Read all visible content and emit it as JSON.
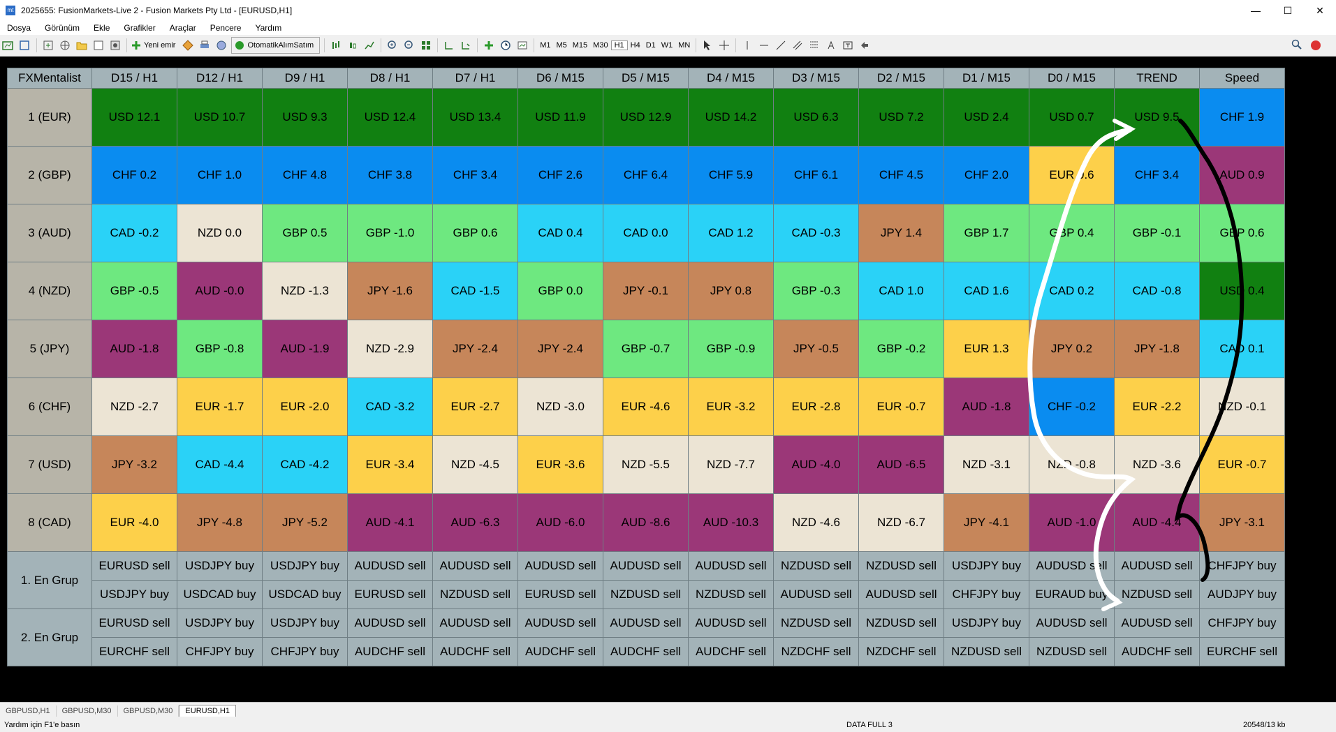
{
  "window": {
    "title": "2025655: FusionMarkets-Live 2 - Fusion Markets Pty Ltd - [EURUSD,H1]",
    "app_icon": "mt",
    "minimize": "—",
    "maximize": "☐",
    "close": "✕"
  },
  "menu": [
    "Dosya",
    "Görünüm",
    "Ekle",
    "Grafikler",
    "Araçlar",
    "Pencere",
    "Yardım"
  ],
  "toolbar": {
    "new_order": "Yeni emir",
    "auto_trading": "OtomatikAlımSatım",
    "timeframes": [
      "M1",
      "M5",
      "M15",
      "M30",
      "H1",
      "H4",
      "D1",
      "W1",
      "MN"
    ]
  },
  "grid": {
    "corner": "FXMentalist",
    "columns": [
      "D15 / H1",
      "D12 / H1",
      "D9 / H1",
      "D8 / H1",
      "D7 / H1",
      "D6 / M15",
      "D5 / M15",
      "D4 / M15",
      "D3 / M15",
      "D2 / M15",
      "D1 / M15",
      "D0 / M15",
      "TREND",
      "Speed"
    ],
    "rows": [
      {
        "label": "1 (EUR)",
        "cells": [
          {
            "t": "USD 12.1",
            "c": "#118011"
          },
          {
            "t": "USD 10.7",
            "c": "#118011"
          },
          {
            "t": "USD 9.3",
            "c": "#118011"
          },
          {
            "t": "USD 12.4",
            "c": "#118011"
          },
          {
            "t": "USD 13.4",
            "c": "#118011"
          },
          {
            "t": "USD 11.9",
            "c": "#118011"
          },
          {
            "t": "USD 12.9",
            "c": "#118011"
          },
          {
            "t": "USD 14.2",
            "c": "#118011"
          },
          {
            "t": "USD 6.3",
            "c": "#118011"
          },
          {
            "t": "USD 7.2",
            "c": "#118011"
          },
          {
            "t": "USD 2.4",
            "c": "#118011"
          },
          {
            "t": "USD 0.7",
            "c": "#118011"
          },
          {
            "t": "USD 9.5",
            "c": "#118011"
          },
          {
            "t": "CHF 1.9",
            "c": "#0a8cf0"
          }
        ]
      },
      {
        "label": "2 (GBP)",
        "cells": [
          {
            "t": "CHF 0.2",
            "c": "#0a8cf0"
          },
          {
            "t": "CHF 1.0",
            "c": "#0a8cf0"
          },
          {
            "t": "CHF 4.8",
            "c": "#0a8cf0"
          },
          {
            "t": "CHF 3.8",
            "c": "#0a8cf0"
          },
          {
            "t": "CHF 3.4",
            "c": "#0a8cf0"
          },
          {
            "t": "CHF 2.6",
            "c": "#0a8cf0"
          },
          {
            "t": "CHF 6.4",
            "c": "#0a8cf0"
          },
          {
            "t": "CHF 5.9",
            "c": "#0a8cf0"
          },
          {
            "t": "CHF 6.1",
            "c": "#0a8cf0"
          },
          {
            "t": "CHF 4.5",
            "c": "#0a8cf0"
          },
          {
            "t": "CHF 2.0",
            "c": "#0a8cf0"
          },
          {
            "t": "EUR 0.6",
            "c": "#fdd04a"
          },
          {
            "t": "CHF 3.4",
            "c": "#0a8cf0"
          },
          {
            "t": "AUD 0.9",
            "c": "#9b3778"
          }
        ]
      },
      {
        "label": "3 (AUD)",
        "cells": [
          {
            "t": "CAD -0.2",
            "c": "#2ad2f7"
          },
          {
            "t": "NZD 0.0",
            "c": "#ece4d4"
          },
          {
            "t": "GBP 0.5",
            "c": "#6ee880"
          },
          {
            "t": "GBP -1.0",
            "c": "#6ee880"
          },
          {
            "t": "GBP 0.6",
            "c": "#6ee880"
          },
          {
            "t": "CAD 0.4",
            "c": "#2ad2f7"
          },
          {
            "t": "CAD 0.0",
            "c": "#2ad2f7"
          },
          {
            "t": "CAD 1.2",
            "c": "#2ad2f7"
          },
          {
            "t": "CAD -0.3",
            "c": "#2ad2f7"
          },
          {
            "t": "JPY 1.4",
            "c": "#c6865a"
          },
          {
            "t": "GBP 1.7",
            "c": "#6ee880"
          },
          {
            "t": "GBP 0.4",
            "c": "#6ee880"
          },
          {
            "t": "GBP -0.1",
            "c": "#6ee880"
          },
          {
            "t": "GBP 0.6",
            "c": "#6ee880"
          }
        ]
      },
      {
        "label": "4 (NZD)",
        "cells": [
          {
            "t": "GBP -0.5",
            "c": "#6ee880"
          },
          {
            "t": "AUD -0.0",
            "c": "#9b3778"
          },
          {
            "t": "NZD -1.3",
            "c": "#ece4d4"
          },
          {
            "t": "JPY -1.6",
            "c": "#c6865a"
          },
          {
            "t": "CAD -1.5",
            "c": "#2ad2f7"
          },
          {
            "t": "GBP 0.0",
            "c": "#6ee880"
          },
          {
            "t": "JPY -0.1",
            "c": "#c6865a"
          },
          {
            "t": "JPY 0.8",
            "c": "#c6865a"
          },
          {
            "t": "GBP -0.3",
            "c": "#6ee880"
          },
          {
            "t": "CAD 1.0",
            "c": "#2ad2f7"
          },
          {
            "t": "CAD 1.6",
            "c": "#2ad2f7"
          },
          {
            "t": "CAD 0.2",
            "c": "#2ad2f7"
          },
          {
            "t": "CAD -0.8",
            "c": "#2ad2f7"
          },
          {
            "t": "USD 0.4",
            "c": "#118011"
          }
        ]
      },
      {
        "label": "5 (JPY)",
        "cells": [
          {
            "t": "AUD -1.8",
            "c": "#9b3778"
          },
          {
            "t": "GBP -0.8",
            "c": "#6ee880"
          },
          {
            "t": "AUD -1.9",
            "c": "#9b3778"
          },
          {
            "t": "NZD -2.9",
            "c": "#ece4d4"
          },
          {
            "t": "JPY -2.4",
            "c": "#c6865a"
          },
          {
            "t": "JPY -2.4",
            "c": "#c6865a"
          },
          {
            "t": "GBP -0.7",
            "c": "#6ee880"
          },
          {
            "t": "GBP -0.9",
            "c": "#6ee880"
          },
          {
            "t": "JPY -0.5",
            "c": "#c6865a"
          },
          {
            "t": "GBP -0.2",
            "c": "#6ee880"
          },
          {
            "t": "EUR 1.3",
            "c": "#fdd04a"
          },
          {
            "t": "JPY 0.2",
            "c": "#c6865a"
          },
          {
            "t": "JPY -1.8",
            "c": "#c6865a"
          },
          {
            "t": "CAD 0.1",
            "c": "#2ad2f7"
          }
        ]
      },
      {
        "label": "6 (CHF)",
        "cells": [
          {
            "t": "NZD -2.7",
            "c": "#ece4d4"
          },
          {
            "t": "EUR -1.7",
            "c": "#fdd04a"
          },
          {
            "t": "EUR -2.0",
            "c": "#fdd04a"
          },
          {
            "t": "CAD -3.2",
            "c": "#2ad2f7"
          },
          {
            "t": "EUR -2.7",
            "c": "#fdd04a"
          },
          {
            "t": "NZD -3.0",
            "c": "#ece4d4"
          },
          {
            "t": "EUR -4.6",
            "c": "#fdd04a"
          },
          {
            "t": "EUR -3.2",
            "c": "#fdd04a"
          },
          {
            "t": "EUR -2.8",
            "c": "#fdd04a"
          },
          {
            "t": "EUR -0.7",
            "c": "#fdd04a"
          },
          {
            "t": "AUD -1.8",
            "c": "#9b3778"
          },
          {
            "t": "CHF -0.2",
            "c": "#0a8cf0"
          },
          {
            "t": "EUR -2.2",
            "c": "#fdd04a"
          },
          {
            "t": "NZD -0.1",
            "c": "#ece4d4"
          }
        ]
      },
      {
        "label": "7 (USD)",
        "cells": [
          {
            "t": "JPY -3.2",
            "c": "#c6865a"
          },
          {
            "t": "CAD -4.4",
            "c": "#2ad2f7"
          },
          {
            "t": "CAD -4.2",
            "c": "#2ad2f7"
          },
          {
            "t": "EUR -3.4",
            "c": "#fdd04a"
          },
          {
            "t": "NZD -4.5",
            "c": "#ece4d4"
          },
          {
            "t": "EUR -3.6",
            "c": "#fdd04a"
          },
          {
            "t": "NZD -5.5",
            "c": "#ece4d4"
          },
          {
            "t": "NZD -7.7",
            "c": "#ece4d4"
          },
          {
            "t": "AUD -4.0",
            "c": "#9b3778"
          },
          {
            "t": "AUD -6.5",
            "c": "#9b3778"
          },
          {
            "t": "NZD -3.1",
            "c": "#ece4d4"
          },
          {
            "t": "NZD -0.8",
            "c": "#ece4d4"
          },
          {
            "t": "NZD -3.6",
            "c": "#ece4d4"
          },
          {
            "t": "EUR -0.7",
            "c": "#fdd04a"
          }
        ]
      },
      {
        "label": "8 (CAD)",
        "cells": [
          {
            "t": "EUR -4.0",
            "c": "#fdd04a"
          },
          {
            "t": "JPY -4.8",
            "c": "#c6865a"
          },
          {
            "t": "JPY -5.2",
            "c": "#c6865a"
          },
          {
            "t": "AUD -4.1",
            "c": "#9b3778"
          },
          {
            "t": "AUD -6.3",
            "c": "#9b3778"
          },
          {
            "t": "AUD -6.0",
            "c": "#9b3778"
          },
          {
            "t": "AUD -8.6",
            "c": "#9b3778"
          },
          {
            "t": "AUD -10.3",
            "c": "#9b3778"
          },
          {
            "t": "NZD -4.6",
            "c": "#ece4d4"
          },
          {
            "t": "NZD -6.7",
            "c": "#ece4d4"
          },
          {
            "t": "JPY -4.1",
            "c": "#c6865a"
          },
          {
            "t": "AUD -1.0",
            "c": "#9b3778"
          },
          {
            "t": "AUD -4.4",
            "c": "#9b3778"
          },
          {
            "t": "JPY -3.1",
            "c": "#c6865a"
          }
        ]
      }
    ],
    "groups": [
      {
        "label": "1. En Grup",
        "rows": [
          [
            "EURUSD sell",
            "USDJPY buy",
            "USDJPY buy",
            "AUDUSD sell",
            "AUDUSD sell",
            "AUDUSD sell",
            "AUDUSD sell",
            "AUDUSD sell",
            "NZDUSD sell",
            "NZDUSD sell",
            "USDJPY buy",
            "AUDUSD sell",
            "AUDUSD sell",
            "CHFJPY buy"
          ],
          [
            "USDJPY buy",
            "USDCAD buy",
            "USDCAD buy",
            "EURUSD sell",
            "NZDUSD sell",
            "EURUSD sell",
            "NZDUSD sell",
            "NZDUSD sell",
            "AUDUSD sell",
            "AUDUSD sell",
            "CHFJPY buy",
            "EURAUD buy",
            "NZDUSD sell",
            "AUDJPY buy"
          ]
        ]
      },
      {
        "label": "2. En Grup",
        "rows": [
          [
            "EURUSD sell",
            "USDJPY buy",
            "USDJPY buy",
            "AUDUSD sell",
            "AUDUSD sell",
            "AUDUSD sell",
            "AUDUSD sell",
            "AUDUSD sell",
            "NZDUSD sell",
            "NZDUSD sell",
            "USDJPY buy",
            "AUDUSD sell",
            "AUDUSD sell",
            "CHFJPY buy"
          ],
          [
            "EURCHF sell",
            "CHFJPY buy",
            "CHFJPY buy",
            "AUDCHF sell",
            "AUDCHF sell",
            "AUDCHF sell",
            "AUDCHF sell",
            "AUDCHF sell",
            "NZDCHF sell",
            "NZDCHF sell",
            "NZDUSD sell",
            "NZDUSD sell",
            "AUDCHF sell",
            "EURCHF sell"
          ]
        ]
      }
    ]
  },
  "tabs": [
    "GBPUSD,H1",
    "GBPUSD,M30",
    "GBPUSD,M30",
    "EURUSD,H1"
  ],
  "active_tab": 3,
  "status": {
    "help": "Yardım için F1'e basın",
    "data": "DATA FULL 3",
    "traffic": "20548/13 kb"
  },
  "colors": {
    "USD": "#118011",
    "CHF": "#0a8cf0",
    "EUR": "#fdd04a",
    "AUD": "#9b3778",
    "CAD": "#2ad2f7",
    "GBP": "#6ee880",
    "NZD": "#ece4d4",
    "JPY": "#c6865a",
    "header": "#a3b3b8",
    "row_header": "#b7b4a8",
    "background": "#000000"
  }
}
